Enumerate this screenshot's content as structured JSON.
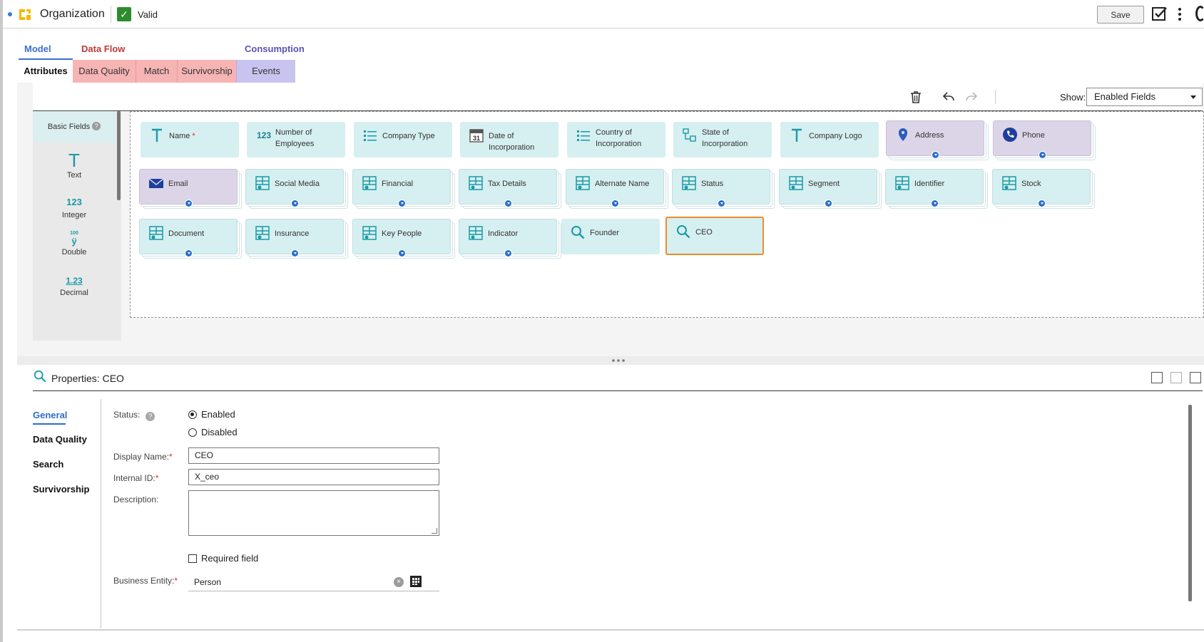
{
  "header": {
    "title": "Organization",
    "status": "Valid",
    "save_label": "Save"
  },
  "tab_groups": {
    "model": "Model",
    "data_flow": "Data Flow",
    "consumption": "Consumption"
  },
  "tabs": {
    "attributes": "Attributes",
    "data_quality": "Data Quality",
    "match": "Match",
    "survivorship": "Survivorship",
    "events": "Events"
  },
  "toolbar": {
    "show_label": "Show:",
    "show_value": "Enabled Fields"
  },
  "palette": {
    "header": "Basic Fields",
    "items": [
      {
        "icon": "T",
        "label": "Text"
      },
      {
        "icon": "123",
        "label": "Integer"
      },
      {
        "icon": "100",
        "label": "Double"
      },
      {
        "icon": "1.23",
        "label": "Decimal"
      }
    ]
  },
  "fields": [
    {
      "label": "Name",
      "required": "*",
      "icon": "text-icon"
    },
    {
      "label": "Number of Employees",
      "icon": "integer-icon"
    },
    {
      "label": "Company Type",
      "icon": "list-icon"
    },
    {
      "label": "Date of Incorporation",
      "icon": "calendar-icon",
      "icon_text": "31"
    },
    {
      "label": "Country of Incorporation",
      "icon": "list-icon"
    },
    {
      "label": "State of Incorporation",
      "icon": "hierarchy-icon"
    },
    {
      "label": "Company Logo",
      "icon": "text-icon"
    },
    {
      "label": "Address",
      "icon": "location-pin-icon"
    },
    {
      "label": "Phone",
      "icon": "phone-icon"
    },
    {
      "label": "Email",
      "icon": "envelope-icon"
    },
    {
      "label": "Social Media",
      "icon": "field-group-icon"
    },
    {
      "label": "Financial",
      "icon": "field-group-icon"
    },
    {
      "label": "Tax Details",
      "icon": "field-group-icon"
    },
    {
      "label": "Alternate Name",
      "icon": "field-group-icon"
    },
    {
      "label": "Status",
      "icon": "field-group-icon"
    },
    {
      "label": "Segment",
      "icon": "field-group-icon"
    },
    {
      "label": "Identifier",
      "icon": "field-group-icon"
    },
    {
      "label": "Stock",
      "icon": "field-group-icon"
    },
    {
      "label": "Document",
      "icon": "field-group-icon"
    },
    {
      "label": "Insurance",
      "icon": "field-group-icon"
    },
    {
      "label": "Key People",
      "icon": "field-group-icon"
    },
    {
      "label": "Indicator",
      "icon": "field-group-icon"
    },
    {
      "label": "Founder",
      "icon": "lookup-icon"
    },
    {
      "label": "CEO",
      "icon": "lookup-icon"
    }
  ],
  "properties": {
    "title": "Properties: CEO",
    "nav": [
      "General",
      "Data Quality",
      "Search",
      "Survivorship"
    ],
    "status_label": "Status:",
    "status_options": [
      "Enabled",
      "Disabled"
    ],
    "selected_status": "Enabled",
    "display_name_label": "Display Name:",
    "display_name_value": "CEO",
    "internal_id_label": "Internal ID:",
    "internal_id_value": "X_ceo",
    "description_label": "Description:",
    "description_value": "",
    "required_label": "Required field",
    "business_entity_label": "Business Entity:",
    "business_entity_value": "Person",
    "required_mark": "*"
  },
  "colors": {
    "accent_blue": "#2a6fcb",
    "model_tab": "#3c6fd1",
    "dataflow_tab": "#c0393b",
    "dataflow_bg": "#f7b4b4",
    "consumption_tab": "#5a52b8",
    "consumption_bg": "#c9c4ef",
    "field_card": "#d6eff0",
    "complex_card": "#dcd5e8",
    "selected_border": "#ef8b2c",
    "valid_green": "#2e8b2e"
  }
}
